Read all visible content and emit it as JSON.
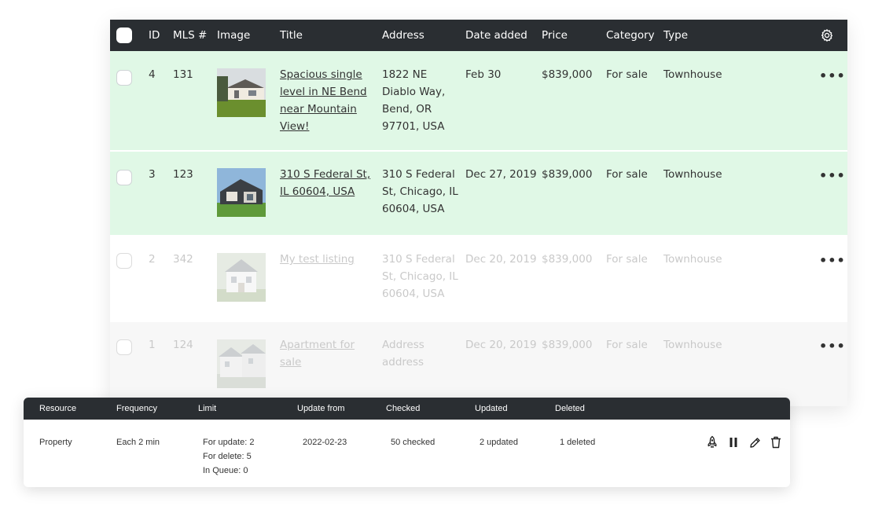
{
  "listings": {
    "columns": {
      "id": "ID",
      "mls": "MLS #",
      "image": "Image",
      "title": "Title",
      "address": "Address",
      "date": "Date added",
      "price": "Price",
      "category": "Category",
      "type": "Type"
    },
    "rows": [
      {
        "id": "4",
        "mls": "131",
        "title_lines": [
          "Spacious single",
          "level in NE Bend",
          "near Mountain",
          "View!"
        ],
        "address_lines": [
          "1822 NE",
          "Diablo Way,",
          "Bend, OR",
          "97701, USA"
        ],
        "date": "Feb 30",
        "price": "$839,000",
        "category": "For sale",
        "type": "Townhouse",
        "image": "house-photo"
      },
      {
        "id": "3",
        "mls": "123",
        "title_lines": [
          "310 S Federal St,",
          "IL 60604, USA"
        ],
        "address_lines": [
          "310 S Federal",
          "St, Chicago, IL",
          "60604, USA"
        ],
        "date": "Dec 27, 2019",
        "price": "$839,000",
        "category": "For sale",
        "type": "Townhouse",
        "image": "house-photo"
      },
      {
        "id": "2",
        "mls": "342",
        "title_lines": [
          "My test listing"
        ],
        "address_lines": [
          "310 S Federal",
          "St, Chicago, IL",
          "60604, USA"
        ],
        "date": "Dec 20, 2019",
        "price": "$839,000",
        "category": "For sale",
        "type": "Townhouse",
        "image": "house-photo"
      },
      {
        "id": "1",
        "mls": "124",
        "title_lines": [
          "Apartment for",
          "sale"
        ],
        "address_lines": [
          "Address",
          "address"
        ],
        "date": "Dec 20, 2019",
        "price": "$839,000",
        "category": "For sale",
        "type": "Townhouse",
        "image": "apartment-photo"
      }
    ],
    "row_menu_label": "•••"
  },
  "import": {
    "columns": {
      "resource": "Resource",
      "frequency": "Frequency",
      "limit": "Limit",
      "update_from": "Update from",
      "checked": "Checked",
      "updated": "Updated",
      "deleted": "Deleted"
    },
    "row": {
      "resource": "Property",
      "frequency": "Each 2 min",
      "limit_update": "For update: 2",
      "limit_delete": "For delete: 5",
      "limit_queue": "In Queue: 0",
      "update_from": "2022-02-23",
      "checked": "50 checked",
      "updated": "2 updated",
      "deleted": "1 deleted"
    },
    "action_icons": [
      "rocket-icon",
      "pause-icon",
      "pencil-icon",
      "trash-icon"
    ]
  },
  "colors": {
    "header_bg": "#2a2e32",
    "active_row_bg": "#e0f8e6",
    "faded_text": "#c9c9c9"
  }
}
